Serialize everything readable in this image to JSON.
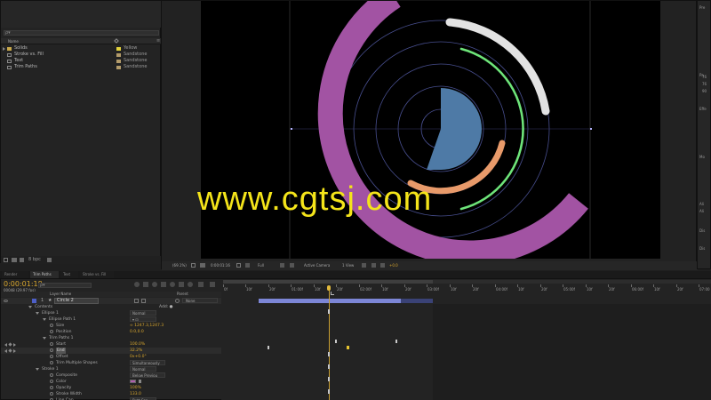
{
  "project": {
    "search_value": "ρ▾",
    "col_name": "Name",
    "col_label": "",
    "items": [
      {
        "name": "Solids",
        "label": "Yellow",
        "color": "#e3d33c",
        "folder": true
      },
      {
        "name": "Stroke vs. Fill",
        "label": "Sandstone",
        "color": "#b39b6a",
        "folder": false
      },
      {
        "name": "Text",
        "label": "Sandstone",
        "color": "#b39b6a",
        "folder": false
      },
      {
        "name": "Trim Paths",
        "label": "Sandstone",
        "color": "#b39b6a",
        "folder": false
      }
    ],
    "footer_bpc": "8 bpc"
  },
  "viewer": {
    "zoom": "(69.1%)",
    "timecode": "0:00:01:16",
    "resolution": "Full",
    "camera": "Active Camera",
    "views": "1 View",
    "exposure": "+0.0"
  },
  "right_panel": {
    "labels": [
      "Pre",
      "Pa",
      "Effe",
      "Mo",
      "Ali",
      "Ali",
      "Dis",
      "Dis"
    ],
    "numbers": [
      "76",
      "76",
      "90"
    ]
  },
  "timeline": {
    "tabs": [
      "Render Queue",
      "Trim Paths",
      "Text",
      "Stroke vs. Fill"
    ],
    "active_tab": "Trim Paths",
    "current_time": "0:00:01:18",
    "frame_info": "00048 (29.97 fps)",
    "search_value": "ρ▾",
    "col_layer_name": "Layer Name",
    "col_parent": "Parent",
    "layer_num": "1",
    "layer_name": "Circle 2",
    "layer_parent": "None",
    "ruler_labels": [
      "0f",
      "10f",
      "20f",
      "01:00f",
      "10f",
      "20f",
      "02:00f",
      "10f",
      "20f",
      "03:00f",
      "10f",
      "20f",
      "04:00f",
      "10f",
      "20f",
      "05:00f",
      "10f",
      "20f",
      "06:00f",
      "10f",
      "20f",
      "07:00"
    ],
    "properties": [
      {
        "indent": 1,
        "name": "Contents",
        "value": "",
        "control": "Add: ●",
        "twirl": true
      },
      {
        "indent": 2,
        "name": "Ellipse 1",
        "value": "",
        "control": "Normal",
        "twirl": true
      },
      {
        "indent": 3,
        "name": "Ellipse Path 1",
        "value": "",
        "control": "▾ ⊡",
        "twirl": true
      },
      {
        "indent": 4,
        "name": "Size",
        "value": "∞ 1247.3,1247.3",
        "control": "",
        "twirl": false
      },
      {
        "indent": 4,
        "name": "Position",
        "value": "0.0,0.0",
        "control": "",
        "twirl": false
      },
      {
        "indent": 3,
        "name": "Trim Paths 1",
        "value": "",
        "control": "",
        "twirl": true
      },
      {
        "indent": 4,
        "name": "Start",
        "value": "100.0%",
        "control": "",
        "twirl": false,
        "kf": true
      },
      {
        "indent": 4,
        "name": "End",
        "value": "32.2%",
        "control": "",
        "twirl": false,
        "kf": true,
        "selected": true
      },
      {
        "indent": 4,
        "name": "Offset",
        "value": "0x+0.0°",
        "control": "",
        "twirl": false
      },
      {
        "indent": 4,
        "name": "Trim Multiple Shapes",
        "value": "",
        "control": "Simultaneously",
        "twirl": false
      },
      {
        "indent": 2,
        "name": "Stroke 1",
        "value": "",
        "control": "Normal",
        "twirl": true
      },
      {
        "indent": 4,
        "name": "Composite",
        "value": "",
        "control": "Below Previou",
        "twirl": false
      },
      {
        "indent": 4,
        "name": "Color",
        "value": "",
        "control": "",
        "twirl": false,
        "color": "#b05cad"
      },
      {
        "indent": 4,
        "name": "Opacity",
        "value": "100%",
        "control": "",
        "twirl": false
      },
      {
        "indent": 4,
        "name": "Stroke Width",
        "value": "133.0",
        "control": "",
        "twirl": false
      },
      {
        "indent": 4,
        "name": "Line Cap",
        "value": "",
        "control": "Butt Cap",
        "twirl": false
      }
    ]
  },
  "watermark": "www.cgtsj.com",
  "colors": {
    "purple_ring": "#a253a3",
    "green_arc": "#6ee57a",
    "white_arc": "#e2e2e2",
    "orange_arc": "#e89a6a",
    "blue_shape": "#4e7aa6",
    "guide": "#474e8e"
  }
}
